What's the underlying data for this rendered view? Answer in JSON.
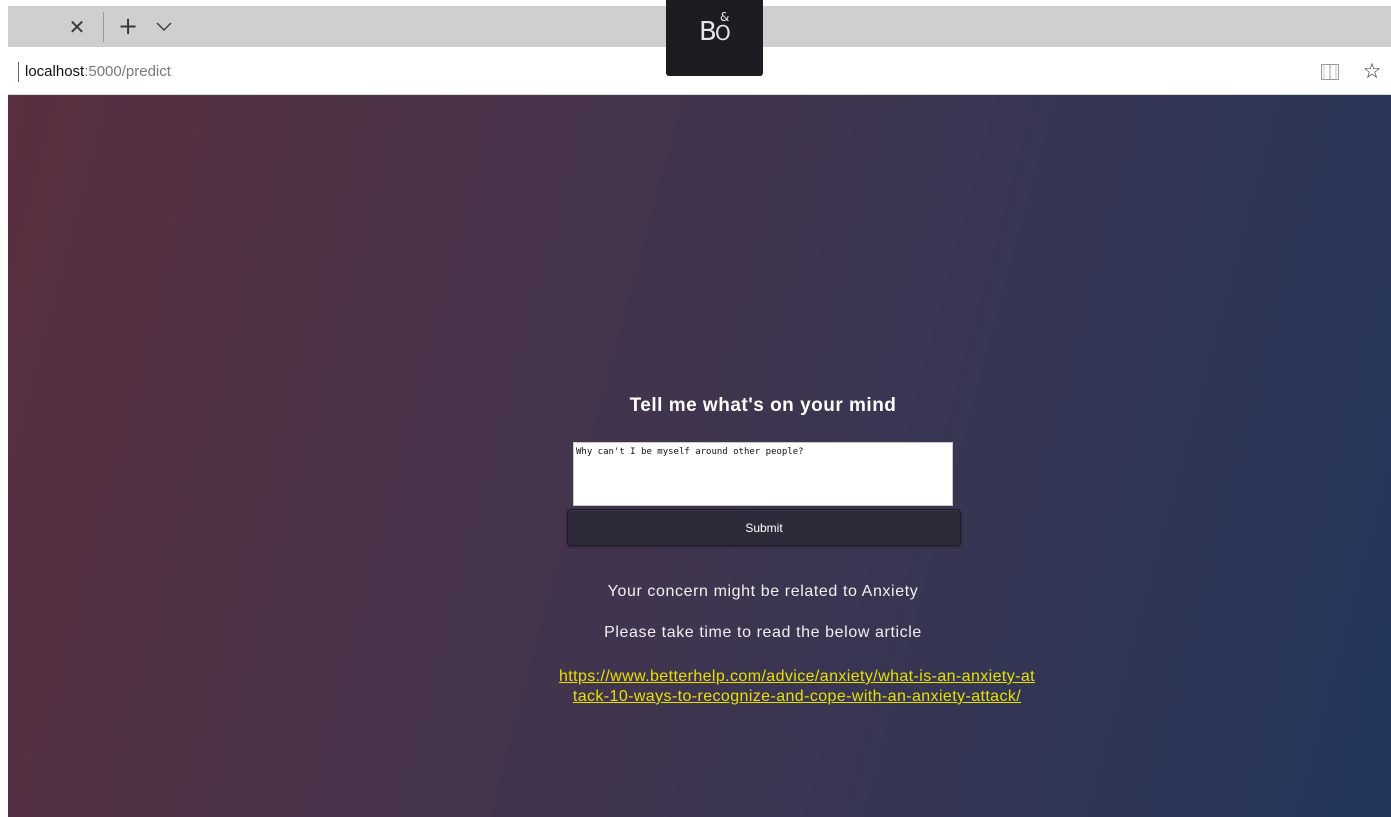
{
  "browser": {
    "url_host": "localhost",
    "url_path": ":5000/predict",
    "badge": {
      "top": "&",
      "left": "B",
      "right": "O"
    },
    "icons": {
      "tab_close": "close-icon",
      "new_tab": "plus-icon",
      "tab_list": "chevron-down-icon",
      "reading_view": "book-icon",
      "favorite": "star-icon"
    }
  },
  "page": {
    "heading": "Tell me what's on your mind",
    "textarea_value": "Why can't I be myself around other people?",
    "submit_label": "Submit",
    "result_line1": "Your concern might be related to Anxiety",
    "result_line2": "Please take time to read the below article",
    "article_url": "https://www.betterhelp.com/advice/anxiety/what-is-an-anxiety-attack-10-ways-to-recognize-and-cope-with-an-anxiety-attack/"
  },
  "colors": {
    "link": "#e8e000",
    "gradient_start": "#5a2f3f",
    "gradient_end": "#23365c"
  }
}
